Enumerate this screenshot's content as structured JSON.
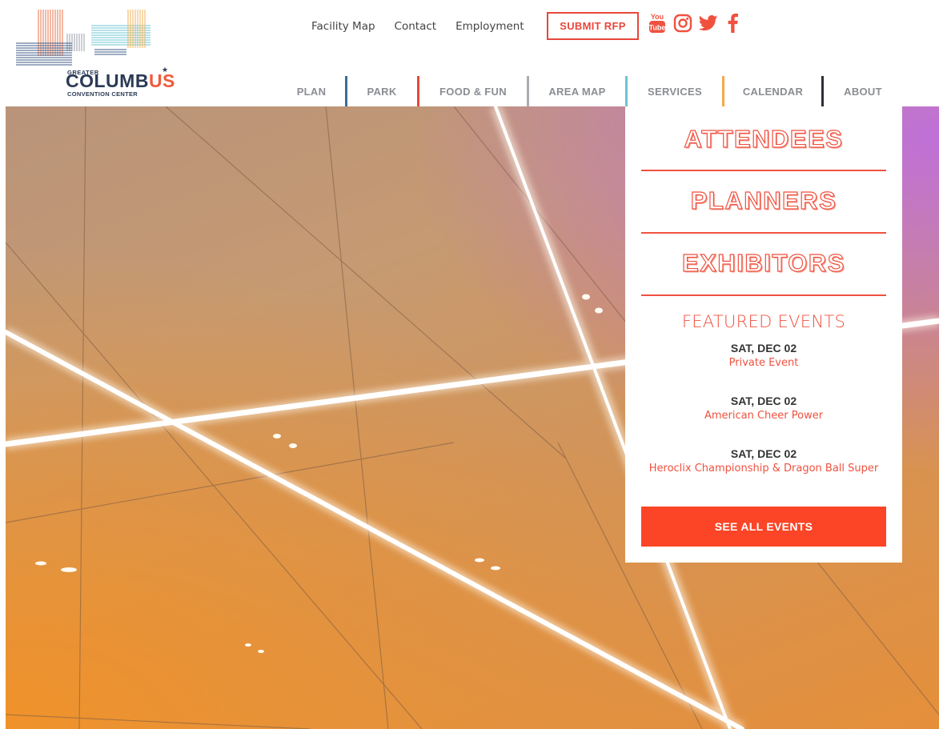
{
  "logo": {
    "line1": "GREATER",
    "line2_main": "COLUMB",
    "line2_accent": "US",
    "line3": "CONVENTION CENTER"
  },
  "header": {
    "top_links": [
      "Facility Map",
      "Contact",
      "Employment"
    ],
    "rfp_label": "SUBMIT RFP",
    "social": [
      "youtube-icon",
      "instagram-icon",
      "twitter-icon",
      "facebook-icon"
    ],
    "youtube_text": "You Tube"
  },
  "nav": {
    "items": [
      "PLAN",
      "PARK",
      "FOOD & FUN",
      "AREA MAP",
      "SERVICES",
      "CALENDAR",
      "ABOUT"
    ],
    "separator_colors": [
      "#3a6e97",
      "#e84a3a",
      "#a9acb0",
      "#6ec3d4",
      "#f5a84a",
      "#2b2f36"
    ]
  },
  "panel": {
    "audiences": [
      "ATTENDEES",
      "PLANNERS",
      "EXHIBITORS"
    ],
    "featured_title": "FEATURED EVENTS",
    "events": [
      {
        "date": "SAT, DEC 02",
        "name": "Private Event"
      },
      {
        "date": "SAT, DEC 02",
        "name": "American Cheer Power"
      },
      {
        "date": "SAT, DEC 02",
        "name": "Heroclix Championship & Dragon Ball Super"
      }
    ],
    "see_all_label": "SEE ALL EVENTS"
  },
  "colors": {
    "accent": "#f0513f",
    "button": "#fb4526",
    "navy": "#2b3a55",
    "nav_text": "#8a8d92"
  }
}
